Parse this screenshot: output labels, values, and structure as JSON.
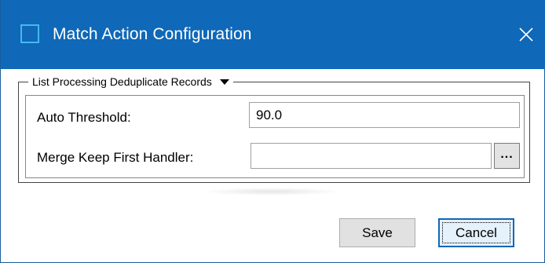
{
  "window": {
    "title": "Match Action Configuration",
    "close_glyph": "✕",
    "icons": {
      "app": "window-icon",
      "close": "close-icon"
    },
    "colors": {
      "titlebar": "#0f68b8",
      "accent": "#45b9f0"
    }
  },
  "group": {
    "title": "List Processing Deduplicate Records",
    "icon": "caret-down-icon",
    "fields": {
      "auto_threshold": {
        "label": "Auto Threshold:",
        "value": "90.0"
      },
      "merge_keep_first": {
        "label": "Merge Keep First Handler:",
        "value": "",
        "browse_label": "..."
      }
    }
  },
  "footer": {
    "save_label": "Save",
    "cancel_label": "Cancel"
  }
}
